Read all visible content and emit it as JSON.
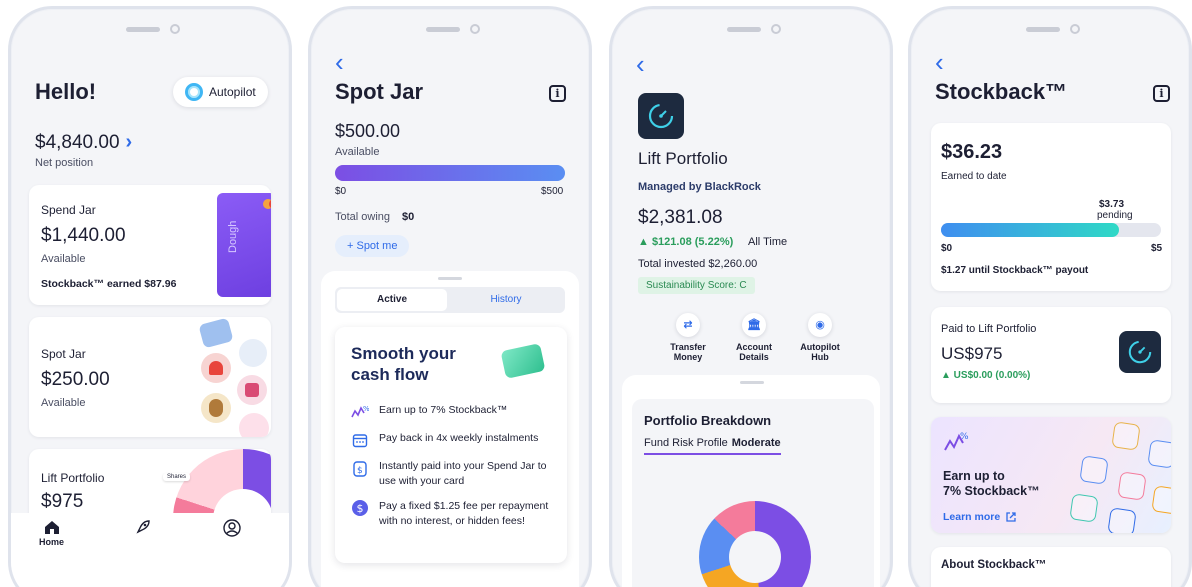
{
  "colors": {
    "accent": "#2f6be8",
    "purple": "#7c4ee4",
    "teal": "#2fd9c6",
    "green": "#2a9d5c",
    "dark": "#1d2a3f"
  },
  "phone1": {
    "greeting": "Hello!",
    "autopilot_label": "Autopilot",
    "net_amount": "$4,840.00",
    "net_chevron": "›",
    "net_label": "Net position",
    "spend": {
      "title": "Spend Jar",
      "amount": "$1,440.00",
      "sub": "Available",
      "earned": "Stockback™ earned $87.96",
      "card_brand": "Dough"
    },
    "spot": {
      "title": "Spot Jar",
      "amount": "$250.00",
      "sub": "Available"
    },
    "lift": {
      "title": "Lift Portfolio",
      "amount": "$975",
      "chip": "Shares"
    },
    "nav": {
      "home": "Home"
    }
  },
  "phone2": {
    "back": "‹",
    "title": "Spot Jar",
    "amount": "$500.00",
    "available": "Available",
    "progress_fraction": 1.0,
    "min": "$0",
    "max": "$500",
    "owing_label": "Total owing",
    "owing_value": "$0",
    "spot_me": "+ Spot me",
    "tab_active": "Active",
    "tab_history": "History",
    "promo_title_1": "Smooth your",
    "promo_title_2": "cash flow",
    "features": [
      {
        "icon": "stockback-squiggle-icon",
        "text": "Earn up to 7% Stockback™"
      },
      {
        "icon": "calendar-icon",
        "text": "Pay back in 4x weekly instalments"
      },
      {
        "icon": "dollar-jar-icon",
        "text": "Instantly paid into your Spend Jar to use with your card"
      },
      {
        "icon": "dollar-coin-icon",
        "text": "Pay a fixed $1.25 fee per repayment with no interest, or hidden fees!"
      }
    ]
  },
  "phone3": {
    "back": "‹",
    "title": "Lift Portfolio",
    "manager": "Managed by BlackRock",
    "value": "$2,381.08",
    "gain": "▲ $121.08 (5.22%)",
    "gain_period": "All Time",
    "invested": "Total invested $2,260.00",
    "sustainability": "Sustainability Score: C",
    "actions": [
      {
        "icon": "transfer-icon",
        "line1": "Transfer",
        "line2": "Money"
      },
      {
        "icon": "bank-icon",
        "line1": "Account",
        "line2": "Details"
      },
      {
        "icon": "autopilot-icon",
        "line1": "Autopilot",
        "line2": "Hub"
      }
    ],
    "breakdown_title": "Portfolio Breakdown",
    "risk_label": "Fund Risk Profile",
    "risk_value": "Moderate"
  },
  "phone4": {
    "back": "‹",
    "title": "Stockback™",
    "earned_amount": "$36.23",
    "earned_label": "Earned to date",
    "pending_amount": "$3.73",
    "pending_label": "pending",
    "progress_fraction": 0.81,
    "min": "$0",
    "max": "$5",
    "until": "$1.27 until Stockback™ payout",
    "paid_label": "Paid to Lift Portfolio",
    "paid_amount": "US$975",
    "paid_gain": "▲ US$0.00 (0.00%)",
    "promo_line1": "Earn up to",
    "promo_line2": "7% Stockback™",
    "learn_more": "Learn more",
    "about": "About Stockback™"
  }
}
